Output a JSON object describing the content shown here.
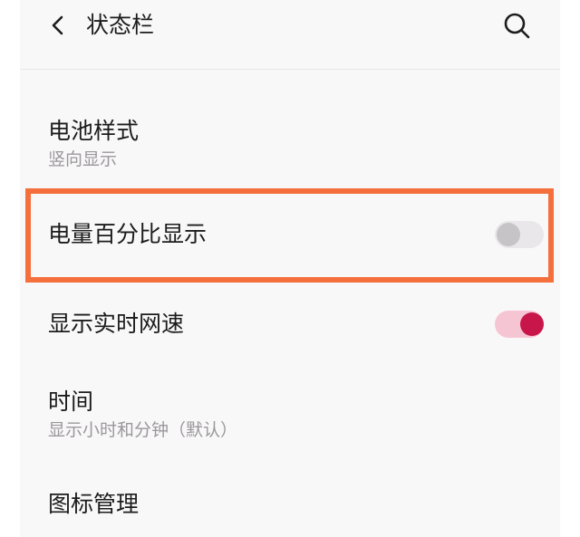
{
  "header": {
    "title": "状态栏"
  },
  "settings": {
    "battery_style": {
      "title": "电池样式",
      "subtitle": "竖向显示"
    },
    "battery_percentage": {
      "title": "电量百分比显示",
      "toggle_on": false
    },
    "network_speed": {
      "title": "显示实时网速",
      "toggle_on": true
    },
    "time": {
      "title": "时间",
      "subtitle": "显示小时和分钟（默认）"
    },
    "icon_management": {
      "title": "图标管理"
    }
  },
  "colors": {
    "highlight_border": "#f46f3c",
    "toggle_on_knob": "#c8164a",
    "toggle_on_track": "#f6c5d3",
    "toggle_off_knob": "#c6c4c6",
    "toggle_off_track": "#e9e7e9"
  }
}
